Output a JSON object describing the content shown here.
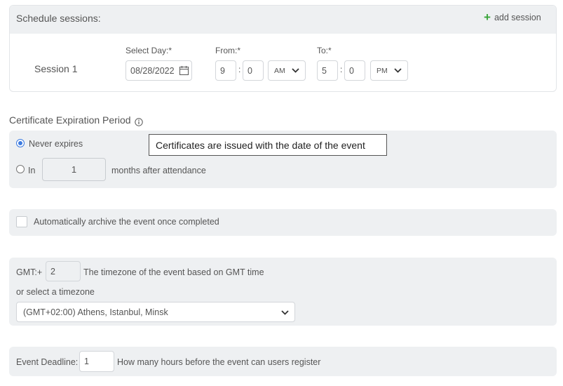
{
  "schedule": {
    "title": "Schedule sessions:",
    "add_session_label": "add session",
    "session": {
      "label": "Session 1",
      "select_day_label": "Select Day:*",
      "date_value": "08/28/2022",
      "from_label": "From:*",
      "from_hour": "9",
      "from_minute": "0",
      "from_ampm": "AM",
      "to_label": "To:*",
      "to_hour": "5",
      "to_minute": "0",
      "to_ampm": "PM",
      "time_separator": ":"
    }
  },
  "certificate": {
    "title": "Certificate Expiration Period",
    "tooltip": "Certificates are issued with the date of the event",
    "never_expires_label": "Never expires",
    "in_label": "In",
    "months_value": "1",
    "months_after_label": "months after attendance"
  },
  "archive": {
    "label": "Automatically archive the event once completed"
  },
  "timezone": {
    "gmt_label": "GMT:+",
    "gmt_value": "2",
    "gmt_description": "The timezone of the event based on GMT time",
    "or_select_label": "or select a timezone",
    "selected_timezone": "(GMT+02:00) Athens, Istanbul, Minsk"
  },
  "deadline": {
    "label": "Event Deadline:",
    "value": "1",
    "description": "How many hours before the event can users register"
  },
  "colors": {
    "panel_bg": "#eef0f2",
    "accent_green": "#3aa53a",
    "radio_blue": "#3d7be0"
  }
}
